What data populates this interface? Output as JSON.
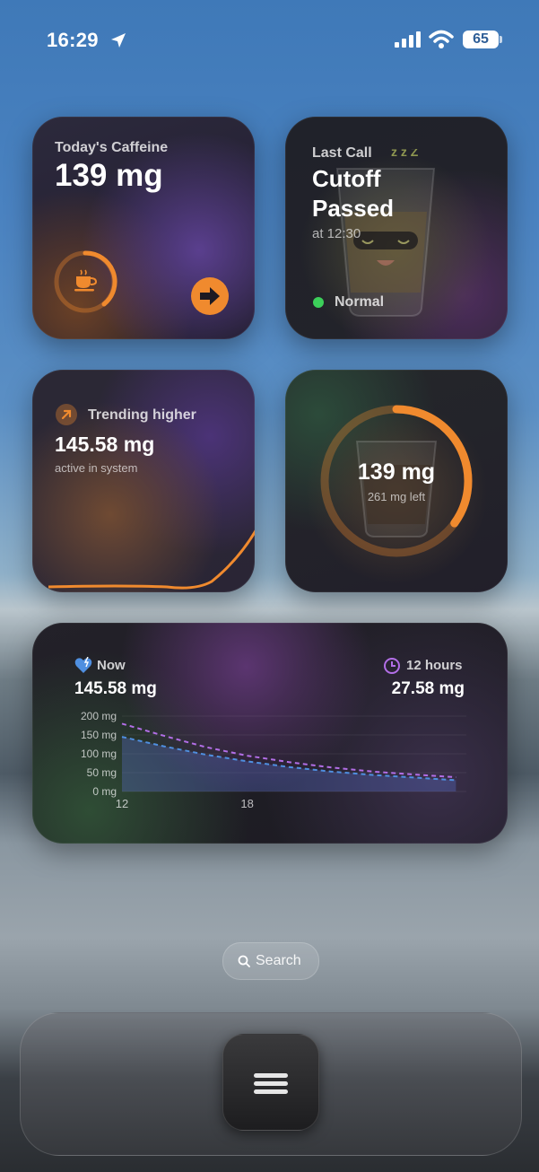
{
  "status_bar": {
    "time": "16:29",
    "battery": "65"
  },
  "widgets": {
    "today": {
      "label": "Today's Caffeine",
      "amount": "139 mg"
    },
    "last_call": {
      "label": "Last Call",
      "title_line1": "Cutoff",
      "title_line2": "Passed",
      "time": "at 12:30",
      "status": "Normal"
    },
    "trend": {
      "label": "Trending higher",
      "amount": "145.58 mg",
      "sub": "active in system"
    },
    "ring": {
      "amount": "139 mg",
      "left": "261 mg left",
      "progress": 0.35
    },
    "decay": {
      "now_label": "Now",
      "now_value": "145.58 mg",
      "later_label": "12 hours",
      "later_value": "27.58 mg",
      "chart_data": {
        "type": "line",
        "y_ticks": [
          "200 mg",
          "150 mg",
          "100 mg",
          "50 mg",
          "0 mg"
        ],
        "x_ticks": [
          "12",
          "18"
        ],
        "ylim": [
          0,
          200
        ],
        "xlim": [
          12,
          28.5
        ],
        "series": [
          {
            "color": "#b26ee6",
            "x": [
              12,
              14,
              16,
              18,
              20,
              22,
              24,
              26,
              28
            ],
            "y": [
              180,
              148,
              118,
              95,
              78,
              64,
              53,
              45,
              38
            ]
          },
          {
            "color": "#4f8fe0",
            "x": [
              12,
              14,
              16,
              18,
              20,
              22,
              24,
              26,
              28
            ],
            "y": [
              145,
              120,
              98,
              80,
              65,
              53,
              44,
              37,
              30
            ]
          }
        ]
      }
    }
  },
  "search": {
    "label": "Search"
  },
  "colors": {
    "accent": "#f08a2e",
    "green": "#3ccf5a"
  }
}
